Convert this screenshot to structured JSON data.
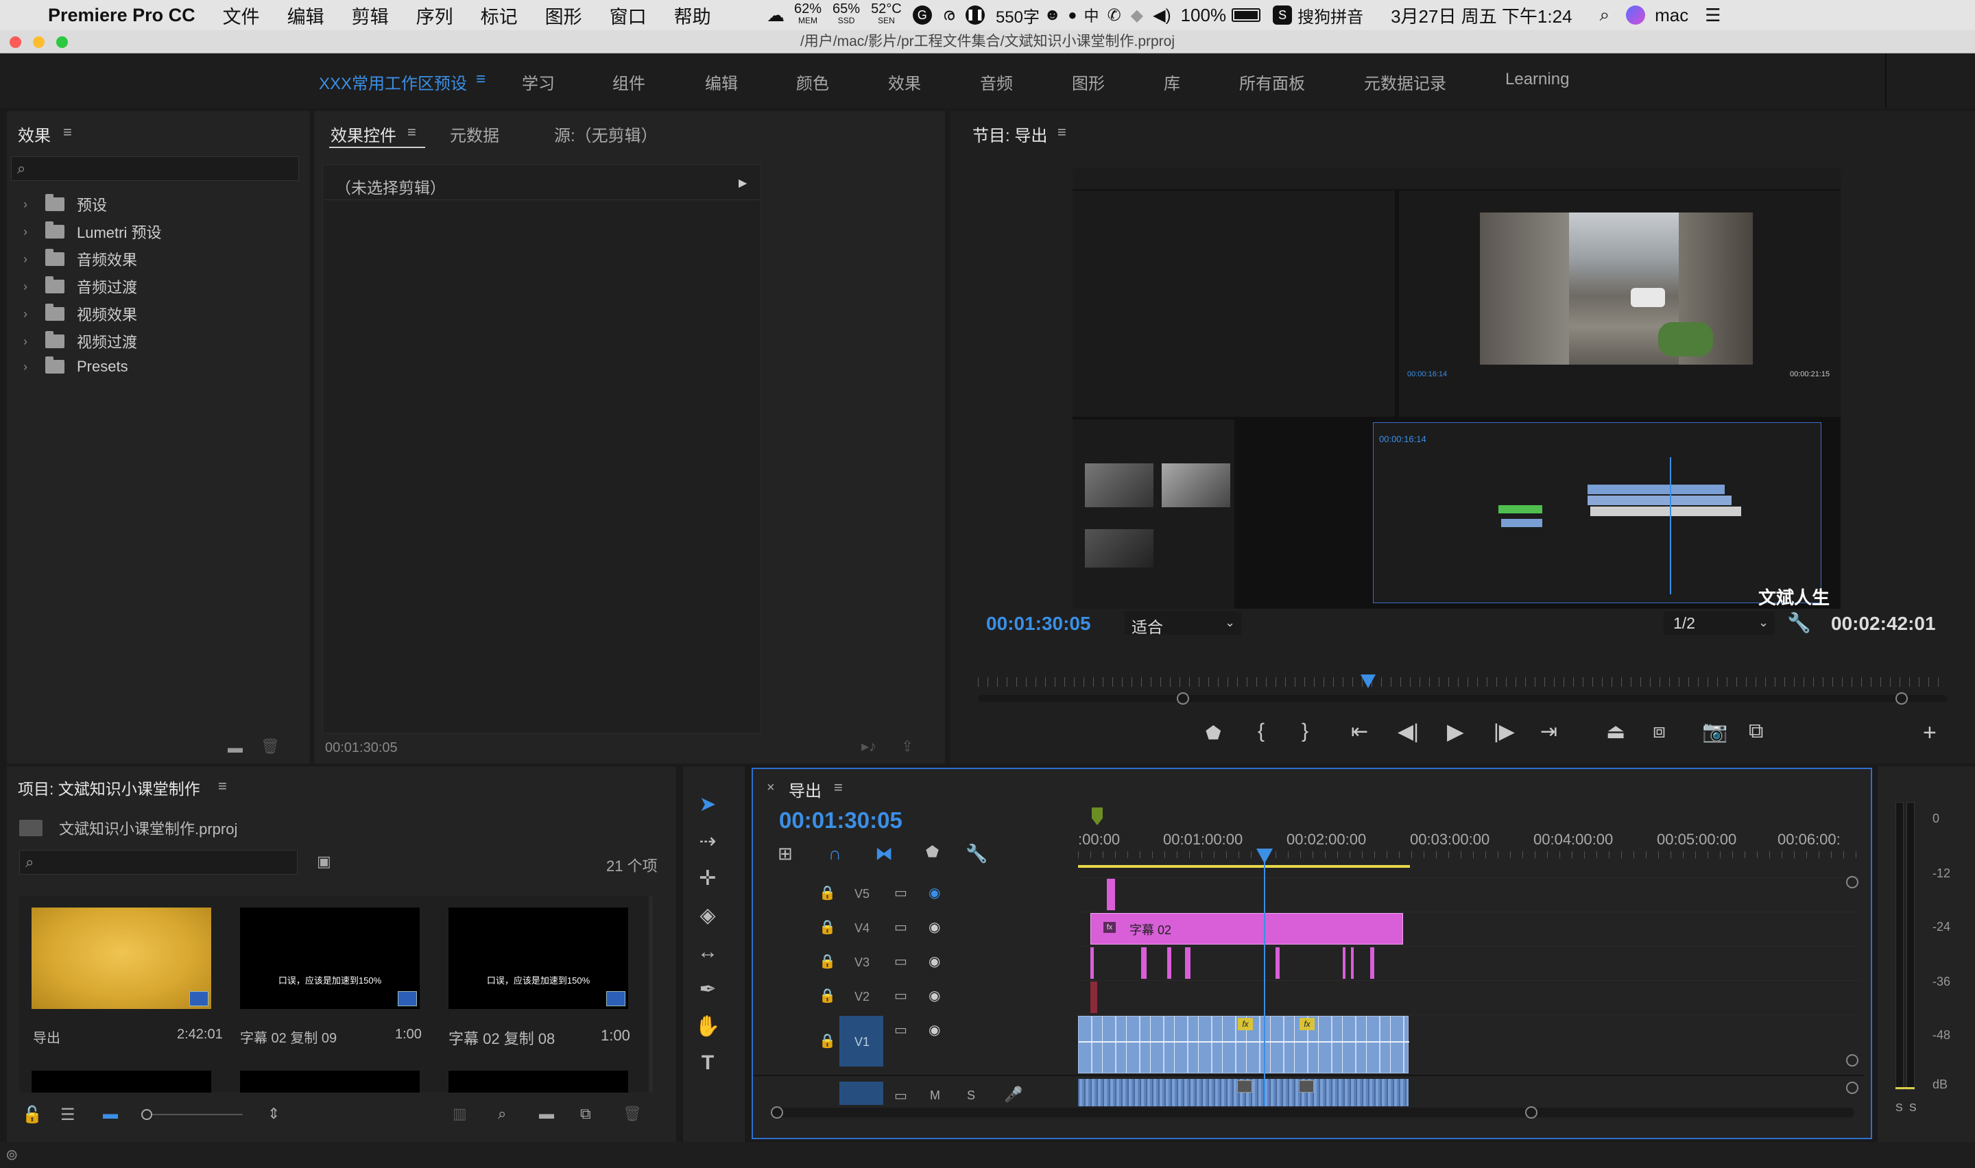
{
  "menubar": {
    "app_name": "Premiere Pro CC",
    "menus": [
      "文件",
      "编辑",
      "剪辑",
      "序列",
      "标记",
      "图形",
      "窗口",
      "帮助"
    ],
    "stats": {
      "mem_pct": "62%",
      "mem_label": "MEM",
      "ssd_pct": "65%",
      "ssd_label": "SSD",
      "temp": "52°C",
      "temp_label": "SEN"
    },
    "word_count": "550字",
    "battery": "100%",
    "input_method": "搜狗拼音",
    "datetime": "3月27日 周五 下午1:24",
    "user": "mac"
  },
  "window": {
    "title": "/用户/mac/影片/pr工程文件集合/文斌知识小课堂制作.prproj"
  },
  "workspace_tabs": [
    {
      "label": "XXX常用工作区预设",
      "active": true
    },
    {
      "label": "学习"
    },
    {
      "label": "组件"
    },
    {
      "label": "编辑"
    },
    {
      "label": "颜色"
    },
    {
      "label": "效果"
    },
    {
      "label": "音频"
    },
    {
      "label": "图形"
    },
    {
      "label": "库"
    },
    {
      "label": "所有面板"
    },
    {
      "label": "元数据记录"
    },
    {
      "label": "Learning"
    }
  ],
  "effects_panel": {
    "title": "效果",
    "items": [
      "预设",
      "Lumetri 预设",
      "音频效果",
      "音频过渡",
      "视频效果",
      "视频过渡",
      "Presets"
    ]
  },
  "effect_controls": {
    "tabs": [
      "效果控件",
      "元数据",
      "源:（无剪辑）"
    ],
    "no_clip": "（未选择剪辑）",
    "timecode": "00:01:30:05"
  },
  "program_monitor": {
    "title": "节目: 导出",
    "timecode": "00:01:30:05",
    "fit": "适合",
    "resolution": "1/2",
    "duration": "00:02:42:01",
    "watermark": "文斌人生"
  },
  "project_panel": {
    "title": "项目: 文斌知识小课堂制作",
    "file": "文斌知识小课堂制作.prproj",
    "count": "21 个项",
    "items": [
      {
        "name": "导出",
        "duration": "2:42:01",
        "caption": ""
      },
      {
        "name": "字幕 02 复制 09",
        "duration": "1:00",
        "caption": "口误，应该是加速到150%"
      },
      {
        "name": "字幕 02 复制 08",
        "duration": "1:00",
        "caption": "口误，应该是加速到150%"
      }
    ]
  },
  "timeline": {
    "title": "导出",
    "timecode": "00:01:30:05",
    "ruler": ":00:00",
    "ruler_ticks": [
      "00:01:00:00",
      "00:02:00:00",
      "00:03:00:00",
      "00:04:00:00",
      "00:05:00:00",
      "00:06:00:"
    ],
    "tracks": [
      "V5",
      "V4",
      "V3",
      "V2",
      "V1"
    ],
    "audio_controls": [
      "M",
      "S"
    ],
    "clip_label": "字幕 02",
    "fx": "fx"
  },
  "meter": {
    "ticks": [
      "0",
      "-12",
      "-24",
      "-36",
      "-48",
      "dB"
    ],
    "solo": [
      "S",
      "S"
    ]
  },
  "colors": {
    "accent": "#3b8fe6",
    "magenta": "#d85fd8",
    "video_blue": "#7a9fd4",
    "playhead": "#3b8fe6"
  }
}
